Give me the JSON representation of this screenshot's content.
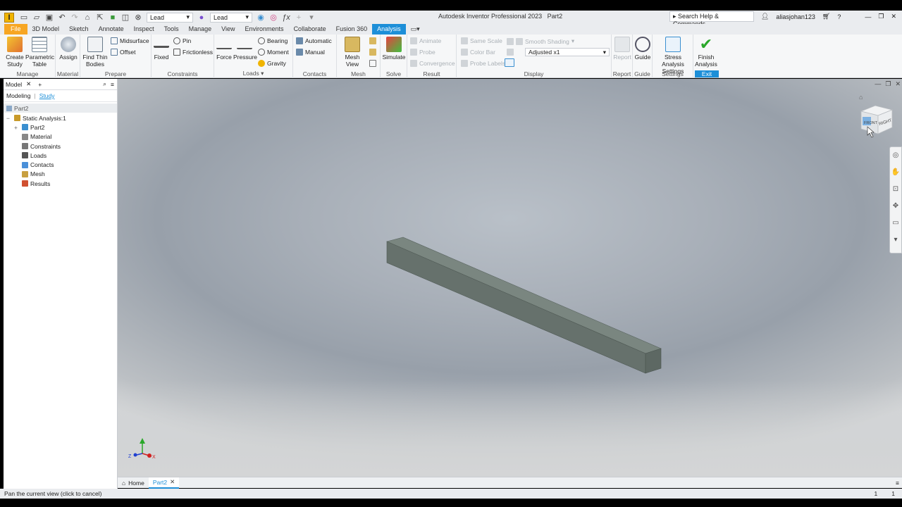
{
  "titlebar": {
    "app_badge": "I",
    "material_select": "Lead",
    "appearance_select": "Lead",
    "title": "Autodesk Inventor Professional 2023",
    "doc_name": "Part2",
    "help_search": "Search Help & Commands...",
    "user": "aliasjohan123",
    "icons": [
      "new-icon",
      "open-icon",
      "save-icon",
      "undo-icon",
      "redo-icon",
      "home-icon",
      "return-icon",
      "update-icon",
      "select-icon",
      "material-icon",
      "appearance-icon",
      "adjust-icon",
      "fx-icon",
      "add-icon",
      "cart-icon",
      "help-icon",
      "minimize-icon",
      "restore-icon",
      "close-icon"
    ]
  },
  "menu": {
    "tabs": [
      "File",
      "3D Model",
      "Sketch",
      "Annotate",
      "Inspect",
      "Tools",
      "Manage",
      "View",
      "Environments",
      "Collaborate",
      "Fusion 360",
      "Analysis"
    ],
    "active": "Analysis"
  },
  "ribbon": {
    "manage": {
      "label": "Manage",
      "create_study": "Create Study",
      "parametric_table": "Parametric Table"
    },
    "material": {
      "label": "Material",
      "assign": "Assign"
    },
    "prepare": {
      "label": "Prepare",
      "find_thin_bodies": "Find Thin Bodies",
      "midsurface": "Midsurface",
      "offset": "Offset"
    },
    "constraints": {
      "label": "Constraints",
      "fixed": "Fixed",
      "pin": "Pin",
      "frictionless": "Frictionless"
    },
    "loads": {
      "label": "Loads",
      "force": "Force",
      "pressure": "Pressure",
      "bearing": "Bearing",
      "moment": "Moment",
      "gravity": "Gravity"
    },
    "contacts": {
      "label": "Contacts",
      "automatic": "Automatic",
      "manual": "Manual"
    },
    "mesh": {
      "label": "Mesh",
      "mesh_view": "Mesh View"
    },
    "solve": {
      "label": "Solve",
      "simulate": "Simulate"
    },
    "result": {
      "label": "Result",
      "animate": "Animate",
      "probe": "Probe",
      "convergence": "Convergence"
    },
    "display": {
      "label": "Display",
      "same_scale": "Same Scale",
      "color_bar": "Color Bar",
      "probe_labels": "Probe Labels",
      "smooth_shading": "Smooth Shading",
      "adjusted": "Adjusted x1"
    },
    "report": {
      "label": "Report",
      "report": "Report"
    },
    "guide": {
      "label": "Guide",
      "guide": "Guide"
    },
    "settings": {
      "label": "Settings",
      "stress_analysis_settings": "Stress Analysis Settings"
    },
    "exit": {
      "label": "Exit",
      "finish_analysis": "Finish Analysis"
    }
  },
  "browser": {
    "title": "Model",
    "modes": [
      "Modeling",
      "Study"
    ],
    "root": "Part2",
    "tree": [
      {
        "label": "Static Analysis:1",
        "indent": 0,
        "color": "#c89a2a"
      },
      {
        "label": "Part2",
        "indent": 1,
        "color": "#3a8fd0"
      },
      {
        "label": "Material",
        "indent": 2,
        "color": "#888888"
      },
      {
        "label": "Constraints",
        "indent": 2,
        "color": "#777777"
      },
      {
        "label": "Loads",
        "indent": 2,
        "color": "#555555"
      },
      {
        "label": "Contacts",
        "indent": 2,
        "color": "#4a90d9"
      },
      {
        "label": "Mesh",
        "indent": 2,
        "color": "#c8a040"
      },
      {
        "label": "Results",
        "indent": 2,
        "color": "#d05030"
      }
    ]
  },
  "viewcube": {
    "face_front": "FRONT",
    "face_right": "RIGHT"
  },
  "triad": {
    "x": "X",
    "y": "Y",
    "z": "Z"
  },
  "doctabs": {
    "home": "Home",
    "active": "Part2"
  },
  "status": {
    "message": "Pan the current view (click to cancel)",
    "count1": "1",
    "count2": "1"
  }
}
